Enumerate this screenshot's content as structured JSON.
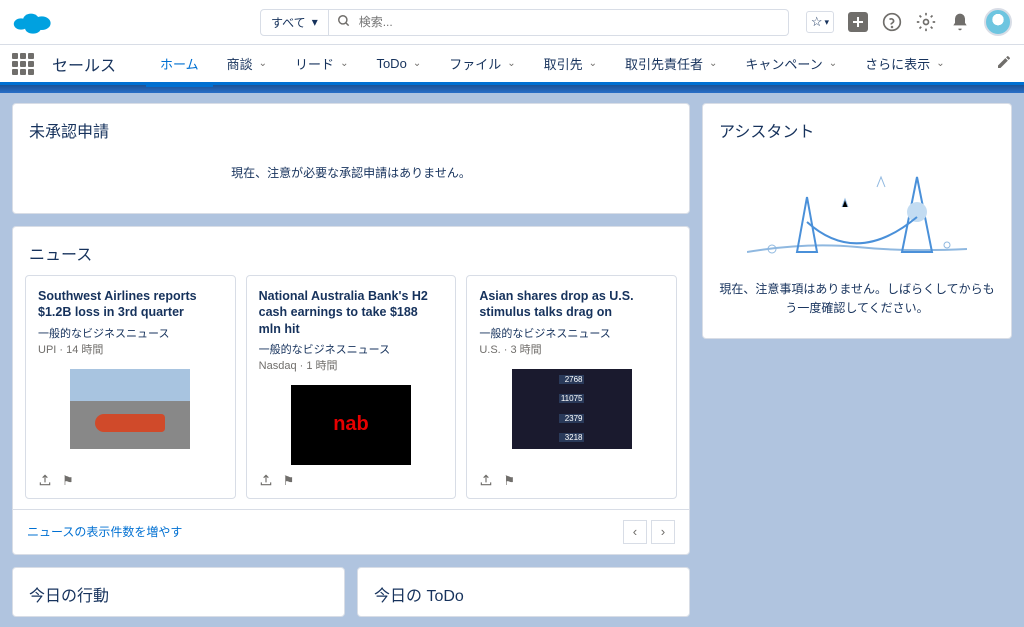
{
  "header": {
    "scope_label": "すべて",
    "search_placeholder": "検索..."
  },
  "nav": {
    "app_name": "セールス",
    "tabs": [
      {
        "label": "ホーム",
        "active": true,
        "dropdown": false
      },
      {
        "label": "商談",
        "dropdown": true
      },
      {
        "label": "リード",
        "dropdown": true
      },
      {
        "label": "ToDo",
        "dropdown": true
      },
      {
        "label": "ファイル",
        "dropdown": true
      },
      {
        "label": "取引先",
        "dropdown": true
      },
      {
        "label": "取引先責任者",
        "dropdown": true
      },
      {
        "label": "キャンペーン",
        "dropdown": true
      },
      {
        "label": "さらに表示",
        "dropdown": true
      }
    ]
  },
  "approval": {
    "title": "未承認申請",
    "empty": "現在、注意が必要な承認申請はありません。"
  },
  "news": {
    "title": "ニュース",
    "items": [
      {
        "headline": "Southwest Airlines reports $1.2B loss in 3rd quarter",
        "category": "一般的なビジネスニュース",
        "source": "UPI",
        "time": "14 時間"
      },
      {
        "headline": "National Australia Bank's H2 cash earnings to take $188 mln hit",
        "category": "一般的なビジネスニュース",
        "source": "Nasdaq",
        "time": "1 時間"
      },
      {
        "headline": "Asian shares drop as U.S. stimulus talks drag on",
        "category": "一般的なビジネスニュース",
        "source": "U.S.",
        "time": "3 時間"
      }
    ],
    "more_label": "ニュースの表示件数を増やす",
    "stock_values": [
      "2768",
      "11075",
      "2379",
      "3218"
    ]
  },
  "assistant": {
    "title": "アシスタント",
    "message": "現在、注意事項はありません。しばらくしてからもう一度確認してください。"
  },
  "bottom": {
    "activity_title": "今日の行動",
    "todo_title": "今日の ToDo"
  }
}
